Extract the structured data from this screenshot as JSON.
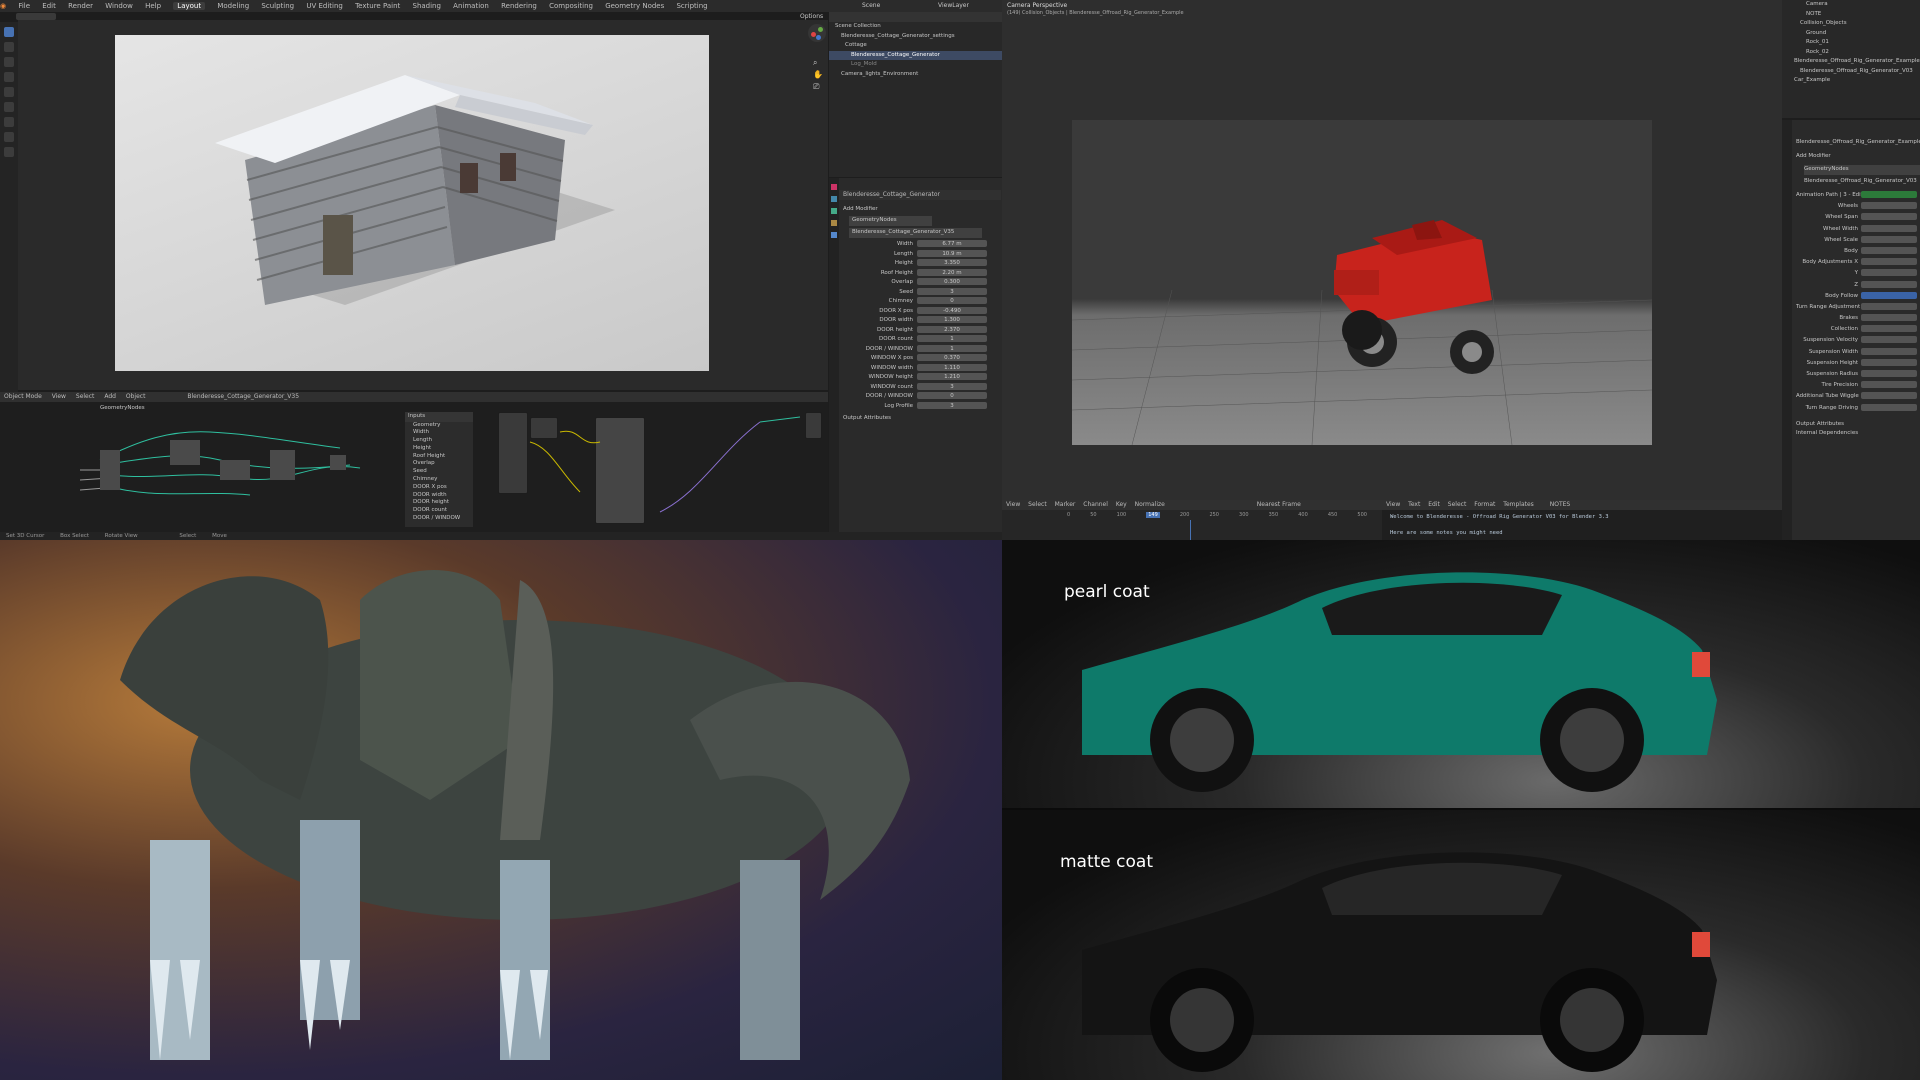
{
  "blender_top": {
    "menu": [
      "File",
      "Edit",
      "Render",
      "Window",
      "Help"
    ],
    "workspaces": [
      "Layout",
      "Modeling",
      "Sculpting",
      "UV Editing",
      "Texture Paint",
      "Shading",
      "Animation",
      "Rendering",
      "Compositing",
      "Geometry Nodes",
      "Scripting"
    ],
    "active_workspace": "Layout",
    "scene": "Scene",
    "view_layer": "ViewLayer",
    "options": "Options",
    "outliner": {
      "items": [
        "Scene Collection",
        "Blenderesse_Cottage_Generator_settings",
        "Cottage",
        "Blenderesse_Cottage_Generator",
        "Log_Mold",
        "Camera_lights_Environment"
      ]
    },
    "properties": {
      "object": "Blenderesse_Cottage_Generator",
      "tab": "Geometry Nodes",
      "add_modifier": "Add Modifier",
      "modifier": "GeometryNodes",
      "nodegroup": "Blenderesse_Cottage_Generator_V35",
      "params": [
        {
          "label": "Width",
          "value": "6.77 m"
        },
        {
          "label": "Length",
          "value": "10.9 m"
        },
        {
          "label": "Height",
          "value": "3.350"
        },
        {
          "label": "Roof Height",
          "value": "2.20 m"
        },
        {
          "label": "Overlap",
          "value": "0.300"
        },
        {
          "label": "Seed",
          "value": "3"
        },
        {
          "label": "Chimney",
          "value": "0"
        },
        {
          "label": "DOOR X pos",
          "value": "-0.490"
        },
        {
          "label": "DOOR width",
          "value": "1.300"
        },
        {
          "label": "DOOR height",
          "value": "2.370"
        },
        {
          "label": "DOOR count",
          "value": "1"
        },
        {
          "label": "DOOR / WINDOW",
          "value": "1"
        },
        {
          "label": "WINDOW X pos",
          "value": "0.370"
        },
        {
          "label": "WINDOW width",
          "value": "1.110"
        },
        {
          "label": "WINDOW height",
          "value": "1.210"
        },
        {
          "label": "WINDOW count",
          "value": "3"
        },
        {
          "label": "DOOR / WINDOW",
          "value": "0"
        },
        {
          "label": "Log Profile",
          "value": "3"
        }
      ],
      "output": "Output Attributes"
    },
    "node_editor": {
      "header": [
        "Object Mode",
        "View",
        "Select",
        "Add",
        "Object"
      ],
      "nodetree": "Blenderesse_Cottage_Generator_V35",
      "group_label": "GeometryNodes",
      "inputs_panel_title": "Inputs",
      "inputs": [
        "Geometry",
        "Width",
        "Length",
        "Height",
        "Roof Height",
        "Overlap",
        "Seed",
        "Chimney",
        "DOOR X pos",
        "DOOR width",
        "DOOR height",
        "DOOR count",
        "DOOR / WINDOW"
      ]
    },
    "status_left": "Set 3D Cursor",
    "status_mid": "Box Select",
    "status_right": "Rotate View",
    "status_sel": "Select",
    "status_move": "Move"
  },
  "blender_right": {
    "viewport_title": "Camera Perspective",
    "viewport_sub": "(149) Collision_Objects | Blenderesse_Offroad_Rig_Generator_Example",
    "timeline": {
      "menu": [
        "View",
        "Select",
        "Marker",
        "Channel",
        "Key"
      ],
      "normalize": "Normalize",
      "frame": "149",
      "ticks": [
        "0",
        "50",
        "100",
        "150",
        "200",
        "250",
        "300",
        "350",
        "400",
        "450",
        "500"
      ],
      "nearest": "Nearest Frame"
    },
    "text_editor": {
      "menu": [
        "View",
        "Text",
        "Edit",
        "Select",
        "Format",
        "Templates"
      ],
      "file": "NOTES",
      "line1": "Welcome to Blenderesse - Offroad Rig Generator V03 for Blender 3.3",
      "line2": "Here are some notes you might need"
    },
    "outliner_items": [
      "Camera",
      "NOTE",
      "Collision_Objects",
      "Ground",
      "Rock_01",
      "Rock_02",
      "Blenderesse_Offroad_Rig_Generator_Example",
      "Blenderesse_Offroad_Rig_Generator_V03",
      "Car_Example"
    ],
    "props": {
      "object": "Blenderesse_Offroad_Rig_Generator_Example",
      "add_modifier": "Add Modifier",
      "modifier": "GeometryNodes",
      "nodegroup": "Blenderesse_Offroad_Rig_Generator_V03",
      "params": [
        "Animation Path | 3 - Edit",
        "Wheels",
        "Wheel Span",
        "Wheel Width",
        "Wheel Scale",
        "Body",
        "Body Adjustments X",
        "Y",
        "Z",
        "Body Follow",
        "Turn Range Adjustment",
        "Brakes",
        "Collection",
        "Suspension Velocity",
        "Suspension Width",
        "Suspension Height",
        "Suspension Radius",
        "Tire Precision",
        "Additional Tube Wiggle",
        "Turn Range Driving"
      ],
      "footer1": "Output Attributes",
      "footer2": "Internal Dependencies"
    }
  },
  "labels": {
    "pearl": "pearl coat",
    "matte": "matte coat"
  },
  "colors": {
    "blender_bg": "#1d1d1d",
    "accent": "#4772b3",
    "car_red": "#c8231c",
    "pearl_green": "#0e7a6a",
    "matte_black": "#141414"
  }
}
